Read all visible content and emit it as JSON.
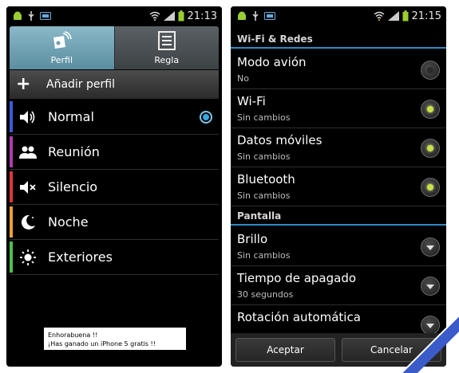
{
  "left_screen": {
    "status_bar": {
      "time": "21:13"
    },
    "tabs": [
      {
        "label": "Perfil",
        "icon": "profile-tab-icon",
        "active": true
      },
      {
        "label": "Regla",
        "icon": "rules-tab-icon",
        "active": false
      }
    ],
    "add_profile": {
      "label": "Añadir perfil",
      "icon": "plus-icon"
    },
    "profiles": [
      {
        "label": "Normal",
        "icon": "speaker-icon",
        "color": "#3b5bdb",
        "selected": true
      },
      {
        "label": "Reunión",
        "icon": "people-icon",
        "color": "#b23ab0",
        "selected": false
      },
      {
        "label": "Silencio",
        "icon": "mute-icon",
        "color": "#e0333c",
        "selected": false
      },
      {
        "label": "Noche",
        "icon": "moon-icon",
        "color": "#f0a030",
        "selected": false
      },
      {
        "label": "Exteriores",
        "icon": "sun-icon",
        "color": "#4cc04c",
        "selected": false
      }
    ],
    "toast": {
      "line1": "Enhorabuena !!",
      "line2": "¡Has ganado un iPhone 5 gratis !!"
    }
  },
  "right_screen": {
    "status_bar": {
      "time": "21:15"
    },
    "sections": {
      "wifi_redes": "Wi-Fi & Redes",
      "pantalla": "Pantalla"
    },
    "settings": [
      {
        "title": "Modo avión",
        "sub": "No",
        "control": "radio",
        "on": false
      },
      {
        "title": "Wi-Fi",
        "sub": "Sin cambios",
        "control": "radio",
        "on": true
      },
      {
        "title": "Datos móviles",
        "sub": "Sin cambios",
        "control": "radio",
        "on": true
      },
      {
        "title": "Bluetooth",
        "sub": "Sin cambios",
        "control": "radio",
        "on": true
      },
      {
        "title": "Brillo",
        "sub": "Sin cambios",
        "control": "dropdown"
      },
      {
        "title": "Tiempo de apagado",
        "sub": "30 segundos",
        "control": "dropdown"
      },
      {
        "title": "Rotación automática",
        "sub": "",
        "control": "dropdown"
      }
    ],
    "buttons": {
      "accept": "Aceptar",
      "cancel": "Cancelar"
    }
  },
  "colors": {
    "accent_blue": "#35a9e4",
    "toggle_on": "#c9e24a",
    "ribbon": "#3a5bc8"
  }
}
